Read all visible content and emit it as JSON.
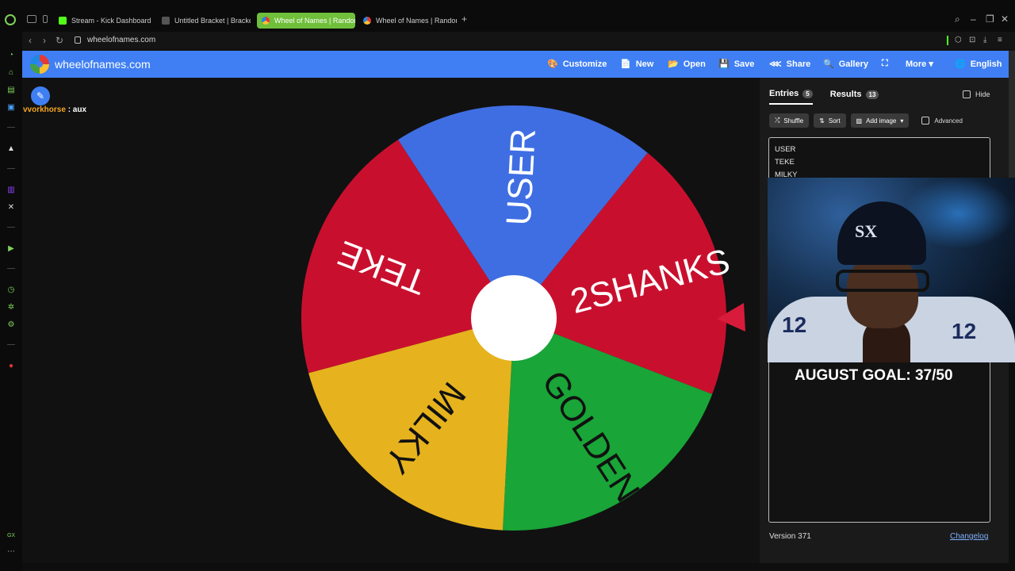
{
  "browser": {
    "tabs": [
      {
        "label": "Stream - Kick Dashboard",
        "color": "#53fc18",
        "active": false
      },
      {
        "label": "Untitled Bracket | Brackets",
        "color": "#555555",
        "active": false
      },
      {
        "label": "Wheel of Names | Random",
        "color": "#e53935",
        "active": true
      },
      {
        "label": "Wheel of Names | Random",
        "color": "#1e88e5",
        "active": false
      }
    ],
    "new_tab": "+",
    "url": "wheelofnames.com"
  },
  "app": {
    "title": "wheelofnames.com",
    "menu": [
      {
        "label": "Customize",
        "icon": "palette-icon",
        "glyph": "🎨"
      },
      {
        "label": "New",
        "icon": "new-file-icon",
        "glyph": "📄"
      },
      {
        "label": "Open",
        "icon": "folder-icon",
        "glyph": "📂"
      },
      {
        "label": "Save",
        "icon": "save-icon",
        "glyph": "💾"
      },
      {
        "label": "Share",
        "icon": "share-icon",
        "glyph": "⋘"
      },
      {
        "label": "Gallery",
        "icon": "search-icon",
        "glyph": "🔍"
      },
      {
        "label": "",
        "icon": "fullscreen-icon",
        "glyph": "⛶"
      },
      {
        "label": "More ▾",
        "icon": "more-icon",
        "glyph": ""
      },
      {
        "label": "English",
        "icon": "globe-icon",
        "glyph": "🌐"
      }
    ],
    "accent": "#3f7ff3"
  },
  "chat": {
    "user": "vvorkhorse",
    "message": " : aux"
  },
  "wheel": {
    "segments": [
      {
        "label": "USER",
        "color": "#3f6ee3"
      },
      {
        "label": "2SHANKS",
        "color": "#c8102e"
      },
      {
        "label": "GOLDEN",
        "color": "#19a537"
      },
      {
        "label": "MILKY",
        "color": "#e6b31e"
      },
      {
        "label": "TEKE",
        "color": "#c8102e"
      }
    ],
    "pointer_color": "#d81b3b"
  },
  "panel": {
    "tabs": [
      {
        "label": "Entries",
        "count": "5"
      },
      {
        "label": "Results",
        "count": "13"
      }
    ],
    "hide_label": "Hide",
    "tools": {
      "shuffle": "Shuffle",
      "sort": "Sort",
      "add_image": "Add image",
      "advanced": "Advanced"
    },
    "entries": [
      "USER",
      "TEKE",
      "MILKY"
    ],
    "version": "Version 371",
    "changelog": "Changelog"
  },
  "overlay": {
    "goal": "AUGUST GOAL: 37/50",
    "cap_logo": "SX",
    "jersey_number_left": "12",
    "jersey_number_right": "12"
  }
}
